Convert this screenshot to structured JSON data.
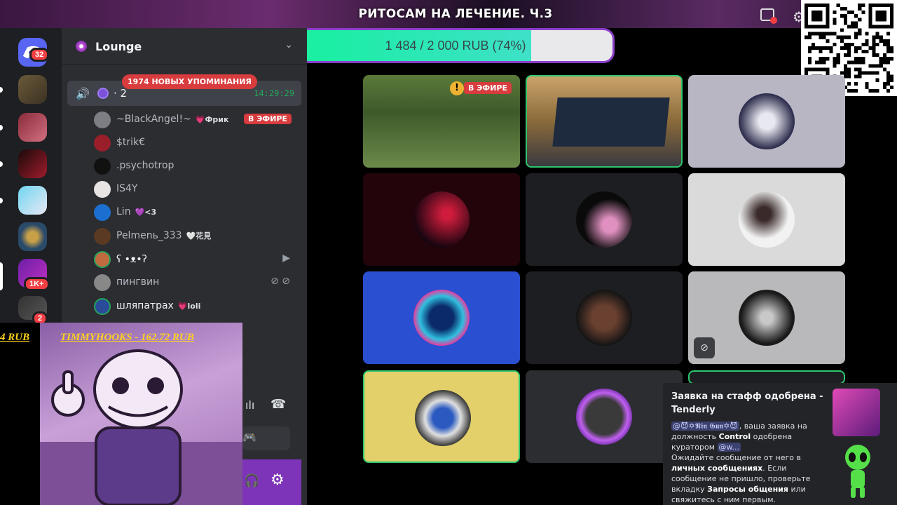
{
  "stream": {
    "title": "РИТОСАМ НА ЛЕЧЕНИЕ. Ч.3",
    "goal_text": "1 484 / 2 000 RUB (74%)",
    "goal_fraction": 0.74
  },
  "rail": {
    "home_badge": "32",
    "badge_1k": "1K+",
    "badge_2": "2"
  },
  "server": {
    "name": "Lounge"
  },
  "mentions_pill": "1974 НОВЫХ УПОМИНАНИЯ",
  "voice": {
    "channel_name": "· 2",
    "time": "14:29:29",
    "live_label": "В ЭФИРЕ",
    "members": [
      {
        "name": "~BlackAngel!~",
        "tag": "Фрик"
      },
      {
        "name": "$trik€",
        "tag": ""
      },
      {
        "name": ".psychotrop",
        "tag": ""
      },
      {
        "name": "IS4Y",
        "tag": ""
      },
      {
        "name": "Lin",
        "tag": "<3"
      },
      {
        "name": "Pelmenь_333",
        "tag": "花見"
      },
      {
        "name": "ʕ •ᴥ•ʔ",
        "tag": ""
      },
      {
        "name": "пингвин",
        "tag": ""
      },
      {
        "name": "шляпатрах",
        "tag": "loli"
      }
    ]
  },
  "donations": {
    "left": "4 RUB",
    "right": "TIMMYHOOKS - 162.72 RUB"
  },
  "grid": {
    "live_label": "В ЭФИРЕ"
  },
  "notification": {
    "title": "Заявка на стафф одобрена - Tenderly",
    "mention_user": "@😈✡𝕹𝖎𝖓 𝕲𝖚𝖓✡😈",
    "text_1": ", ваша заявка на должность ",
    "role": "Control",
    "text_2": " одобрена куратором ",
    "curator": "@w...",
    "text_3": "Ожидайте сообщение от него в ",
    "dm": "личных сообщениях",
    "text_4": ". Если сообщение не пришло, проверьте вкладку ",
    "requests": "Запросы общения",
    "text_5": " или свяжитесь с ним первым."
  }
}
